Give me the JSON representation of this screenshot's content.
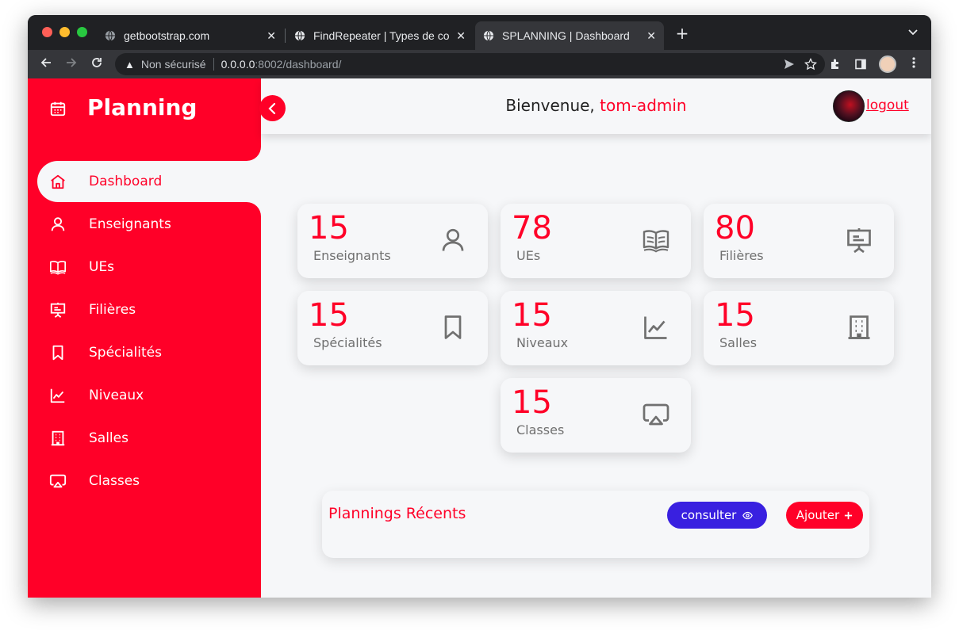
{
  "browser": {
    "tabs": [
      {
        "title": "getbootstrap.com",
        "active": false
      },
      {
        "title": "FindRepeater | Types de co",
        "active": false
      },
      {
        "title": "SPLANNING | Dashboard",
        "active": true
      }
    ],
    "new_tab": "+",
    "menu": "⌄",
    "address": {
      "security_label": "Non sécurisé",
      "host": "0.0.0.0",
      "path": ":8002/dashboard/"
    }
  },
  "sidebar": {
    "brand": "Planning",
    "items": [
      {
        "label": "Dashboard",
        "icon": "home-icon",
        "active": true
      },
      {
        "label": "Enseignants",
        "icon": "user-icon",
        "active": false
      },
      {
        "label": "UEs",
        "icon": "book-icon",
        "active": false
      },
      {
        "label": "Filières",
        "icon": "presentation-icon",
        "active": false
      },
      {
        "label": "Spécialités",
        "icon": "bookmark-icon",
        "active": false
      },
      {
        "label": "Niveaux",
        "icon": "chart-line-icon",
        "active": false
      },
      {
        "label": "Salles",
        "icon": "building-icon",
        "active": false
      },
      {
        "label": "Classes",
        "icon": "airplay-icon",
        "active": false
      }
    ]
  },
  "header": {
    "welcome": "Bienvenue,",
    "username": "tom-admin",
    "logout": "logout"
  },
  "stats": [
    {
      "value": "15",
      "label": "Enseignants",
      "icon": "user-icon"
    },
    {
      "value": "78",
      "label": "UEs",
      "icon": "book-icon"
    },
    {
      "value": "80",
      "label": "Filières",
      "icon": "presentation-icon"
    },
    {
      "value": "15",
      "label": "Spécialités",
      "icon": "bookmark-icon"
    },
    {
      "value": "15",
      "label": "Niveaux",
      "icon": "chart-line-icon"
    },
    {
      "value": "15",
      "label": "Salles",
      "icon": "building-icon"
    },
    {
      "value": "15",
      "label": "Classes",
      "icon": "airplay-icon"
    }
  ],
  "recent": {
    "title": "Plannings Récents",
    "consult_label": "consulter",
    "add_label": "Ajouter"
  },
  "colors": {
    "primary": "#ff0028",
    "consult": "#3920e0",
    "background": "#f6f7f9",
    "muted_text": "#707070"
  }
}
